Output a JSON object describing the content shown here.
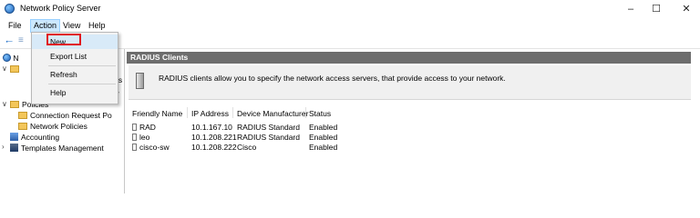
{
  "window": {
    "title": "Network Policy Server"
  },
  "menu": {
    "items": [
      "File",
      "Action",
      "View",
      "Help"
    ]
  },
  "action_menu": {
    "items": [
      "New",
      "Export List",
      "Refresh",
      "Help"
    ]
  },
  "tree": {
    "network_partial": "N",
    "rs_partial": "rs",
    "r_partial": "r",
    "policies": "Policies",
    "connection_request": "Connection Request Po",
    "network_policies": "Network Policies",
    "accounting": "Accounting",
    "templates": "Templates Management"
  },
  "content": {
    "header": "RADIUS Clients",
    "description": "RADIUS clients allow you to specify the network access servers, that provide access to your network.",
    "columns": [
      "Friendly Name",
      "IP Address",
      "Device Manufacturer",
      "Status"
    ],
    "rows": [
      [
        "RAD",
        "10.1.167.10",
        "RADIUS Standard",
        "Enabled"
      ],
      [
        "leo",
        "10.1.208.221",
        "RADIUS Standard",
        "Enabled"
      ],
      [
        "cisco-sw",
        "10.1.208.222",
        "Cisco",
        "Enabled"
      ]
    ]
  },
  "colors": {
    "highlight_border": "#e0191f",
    "header_bg": "#6d6d6d"
  }
}
